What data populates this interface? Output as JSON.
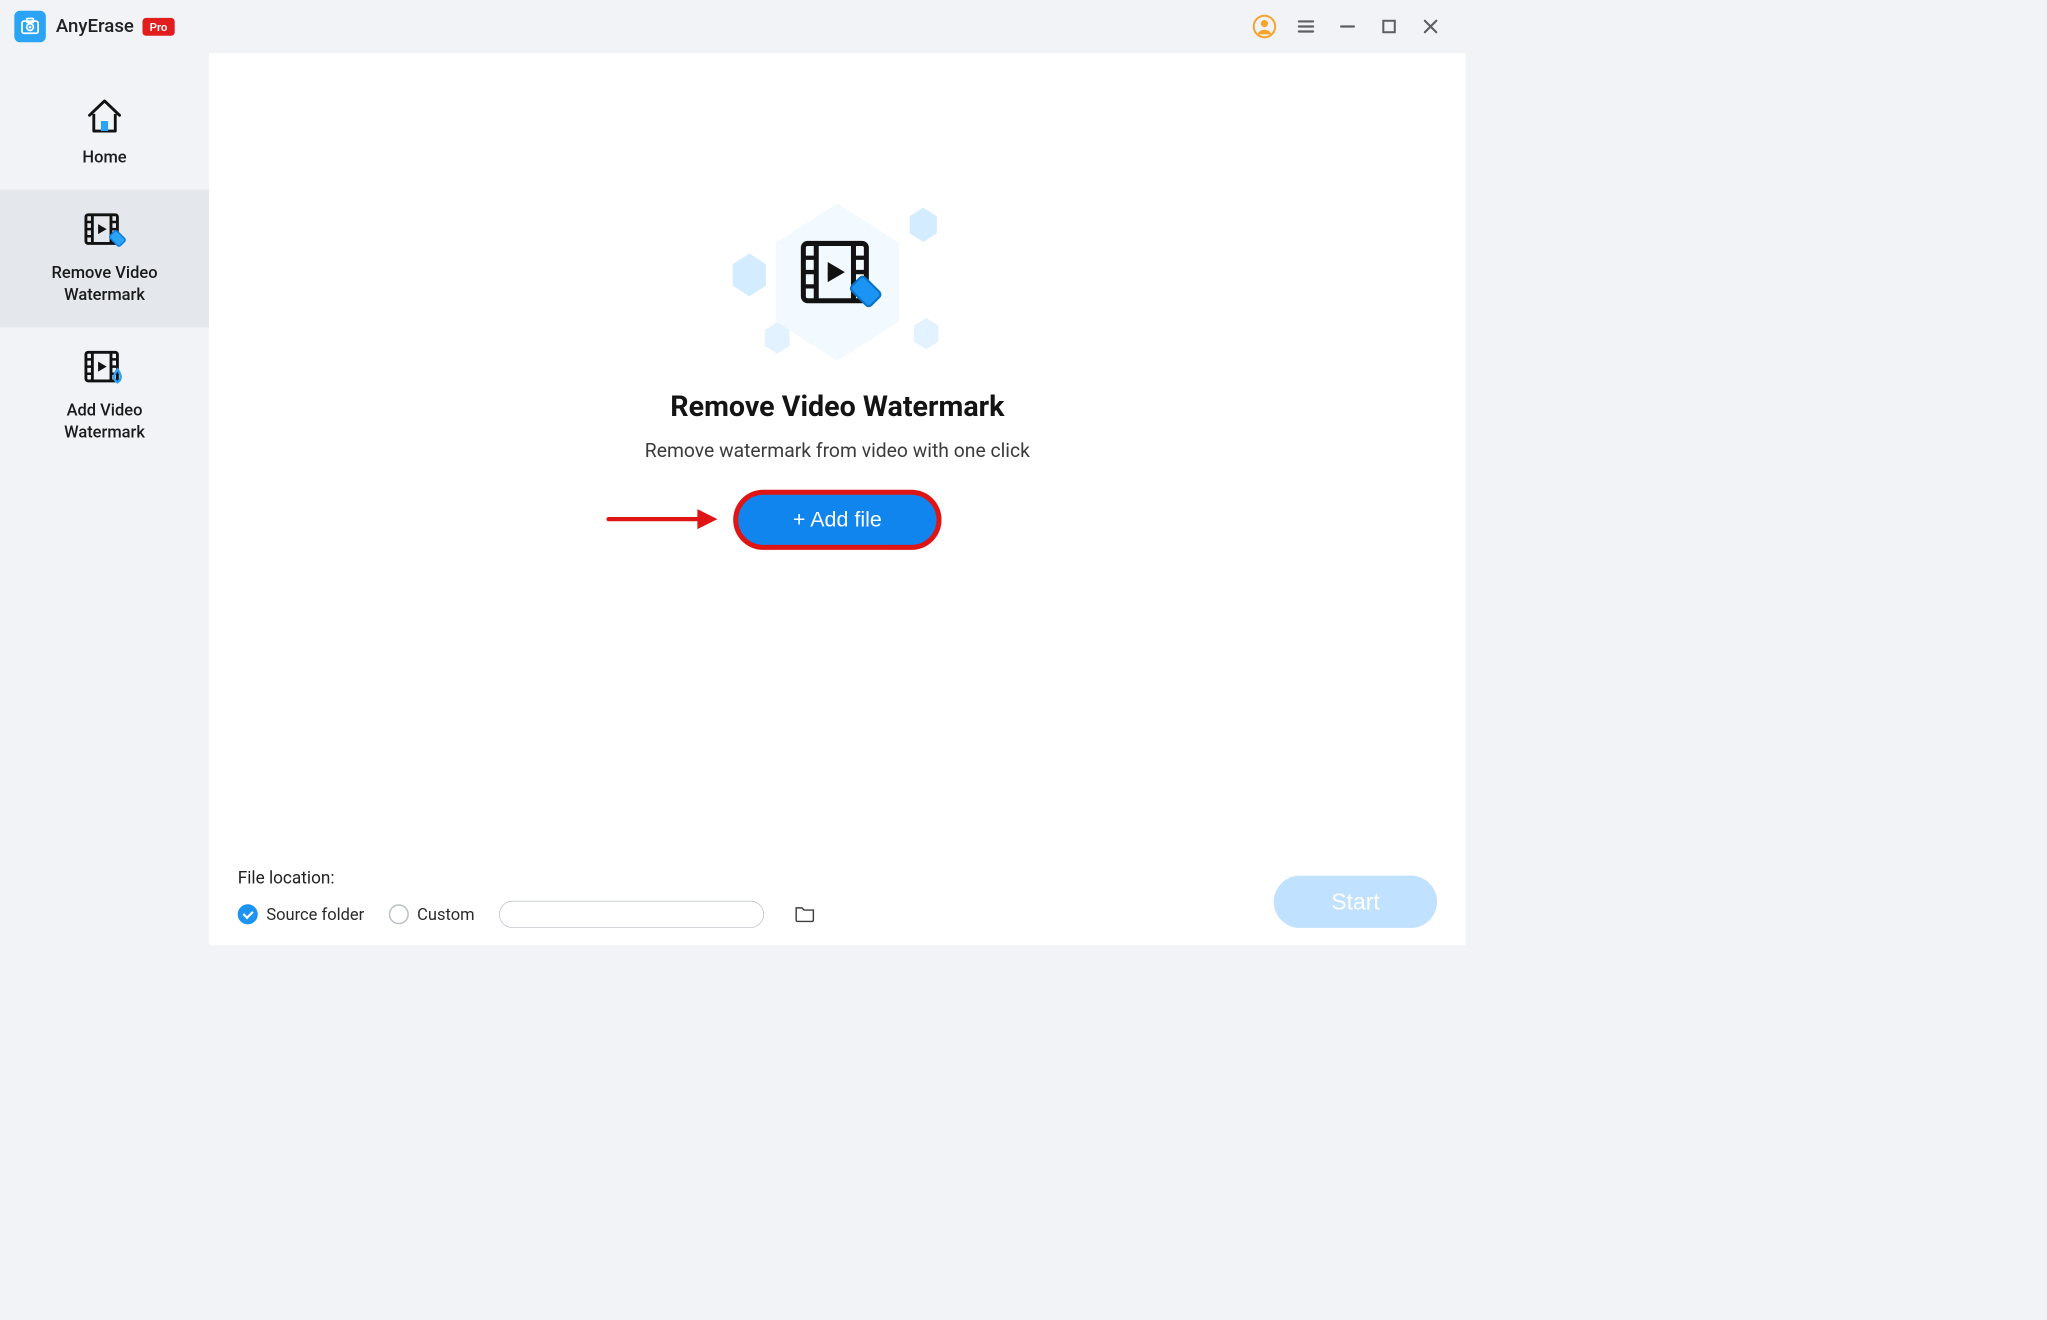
{
  "app": {
    "name": "AnyErase",
    "badge": "Pro"
  },
  "sidebar": {
    "items": [
      {
        "label": "Home"
      },
      {
        "label": "Remove Video Watermark"
      },
      {
        "label": "Add Video Watermark"
      }
    ],
    "active_index": 1
  },
  "main": {
    "title": "Remove Video Watermark",
    "subtitle": "Remove watermark from video with one click",
    "add_file_label": "+ Add file"
  },
  "bottom": {
    "file_location_label": "File location:",
    "option_source": "Source folder",
    "option_custom": "Custom",
    "selected": "source",
    "custom_path": "",
    "start_label": "Start"
  }
}
